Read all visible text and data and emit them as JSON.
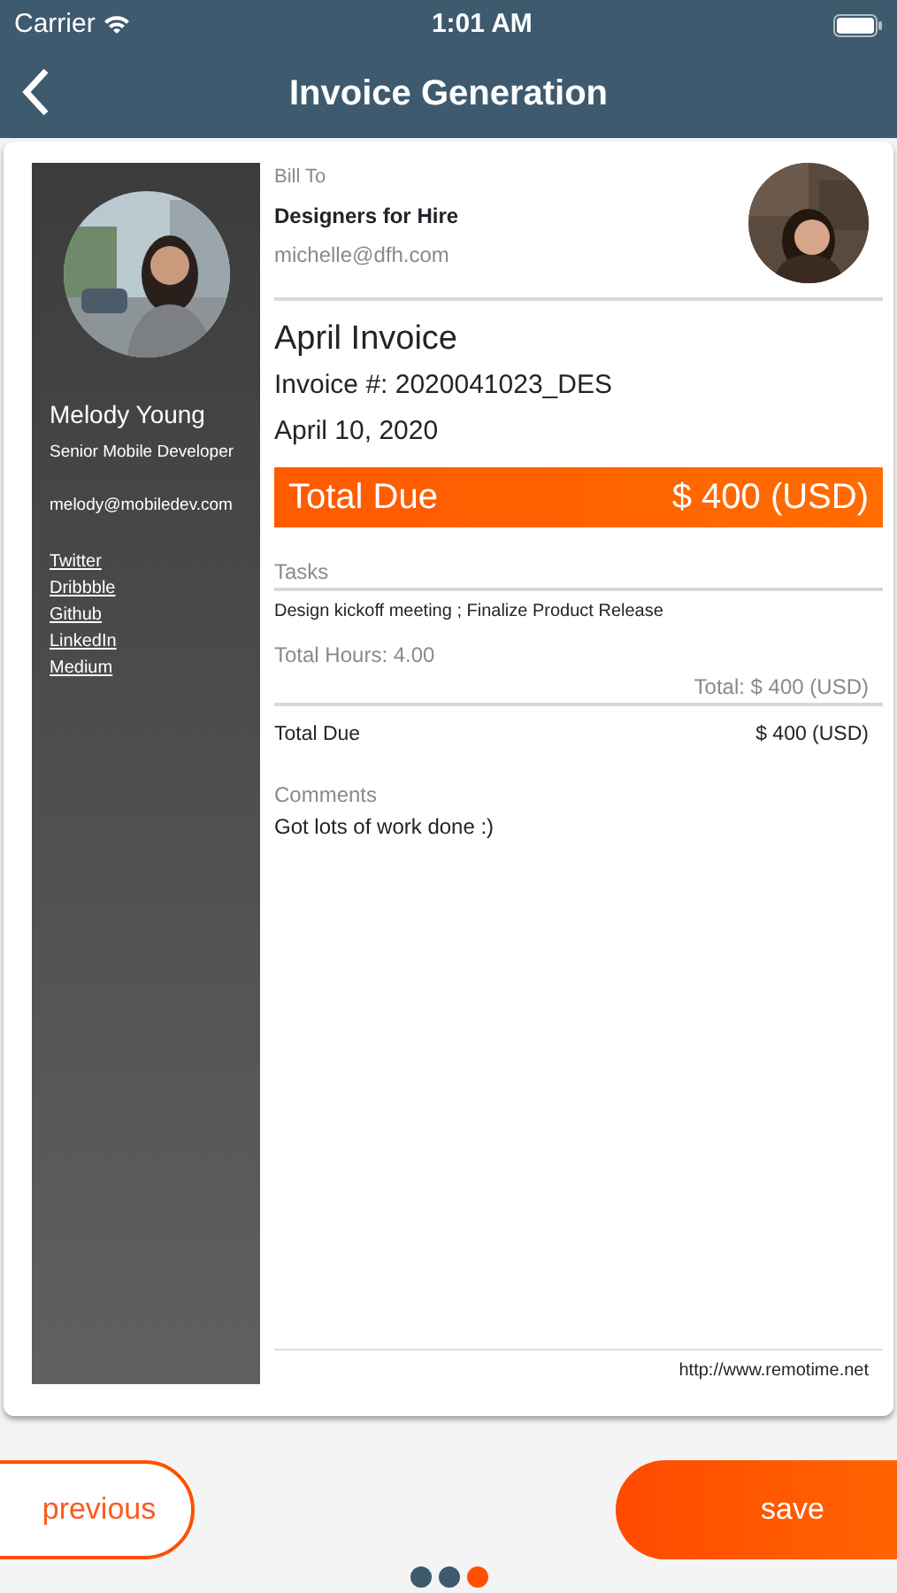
{
  "status_bar": {
    "carrier": "Carrier",
    "time": "1:01 AM"
  },
  "nav": {
    "title": "Invoice Generation"
  },
  "profile": {
    "name": "Melody Young",
    "role": "Senior Mobile Developer",
    "email": "melody@mobiledev.com",
    "links": [
      "Twitter",
      "Dribbble",
      "Github",
      "LinkedIn",
      "Medium"
    ]
  },
  "bill_to": {
    "label": "Bill To",
    "company": "Designers for Hire",
    "email": "michelle@dfh.com"
  },
  "invoice": {
    "title": "April Invoice",
    "number": "Invoice #: 2020041023_DES",
    "date": "April 10, 2020"
  },
  "total_due_banner": {
    "label": "Total Due",
    "amount": "$ 400 (USD)"
  },
  "tasks": {
    "label": "Tasks",
    "items": "Design kickoff meeting ; Finalize Product Release",
    "hours": "Total Hours: 4.00",
    "total": "Total: $ 400 (USD)"
  },
  "total_due": {
    "label": "Total Due",
    "amount": "$ 400 (USD)"
  },
  "comments": {
    "label": "Comments",
    "text": "Got lots of work done :)"
  },
  "footer_url": "http://www.remotime.net",
  "buttons": {
    "previous": "previous",
    "save": "save"
  },
  "pager": [
    {
      "selected": false
    },
    {
      "selected": false
    },
    {
      "selected": true
    }
  ]
}
